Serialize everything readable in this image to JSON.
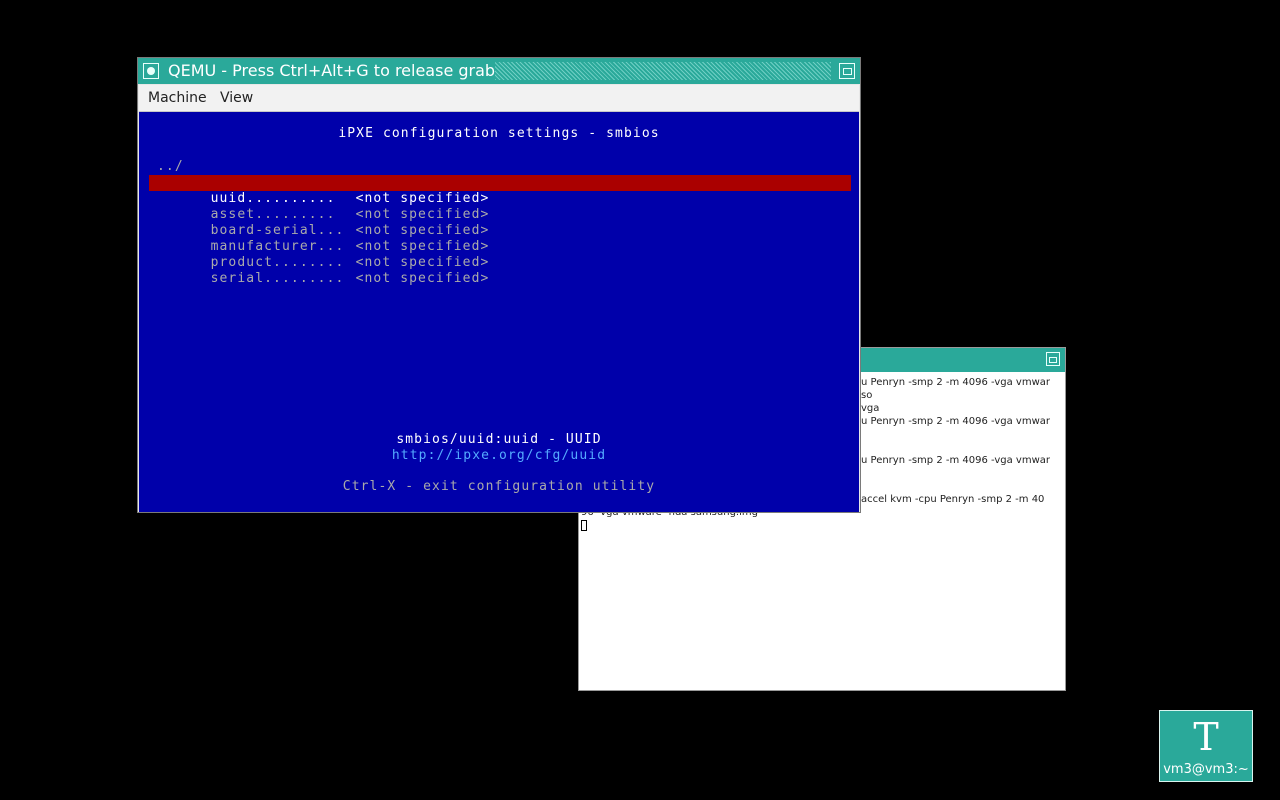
{
  "qemu": {
    "title": "QEMU - Press Ctrl+Alt+G to release grab",
    "menu": [
      "Machine",
      "View"
    ]
  },
  "ipxe": {
    "title": "iPXE configuration settings - smbios",
    "parent": "../",
    "rows": [
      {
        "key": "uuid..........",
        "value": "<not specified>",
        "selected": true
      },
      {
        "key": "asset.........",
        "value": "<not specified>",
        "selected": false
      },
      {
        "key": "board-serial...",
        "value": "<not specified>",
        "selected": false
      },
      {
        "key": "manufacturer...",
        "value": "<not specified>",
        "selected": false
      },
      {
        "key": "product........",
        "value": "<not specified>",
        "selected": false
      },
      {
        "key": "serial.........",
        "value": "<not specified>",
        "selected": false
      }
    ],
    "help_title": "smbios/uuid:uuid - UUID",
    "help_link": "http://ipxe.org/cfg/uuid",
    "exit_hint": "Ctrl-X - exit configuration utility"
  },
  "xterm": {
    "lines": [
      "u Penryn -smp 2 -m 4096 -vga vmwar",
      "so",
      "vga",
      "u Penryn -smp 2 -m 4096 -vga vmwar",
      "",
      "",
      "u Penryn -smp 2 -m 4096 -vga vmwar",
      "",
      "",
      "accel kvm -cpu Penryn -smp 2 -m 40",
      "96 -vga vmware -hda samsung.img"
    ]
  },
  "desktop_icon": {
    "glyph": "T",
    "label": "vm3@vm3:~"
  },
  "colors": {
    "titlebar": "#2aa99a",
    "screen_bg": "#0000aa",
    "selection": "#aa0000",
    "link": "#55aaff"
  }
}
